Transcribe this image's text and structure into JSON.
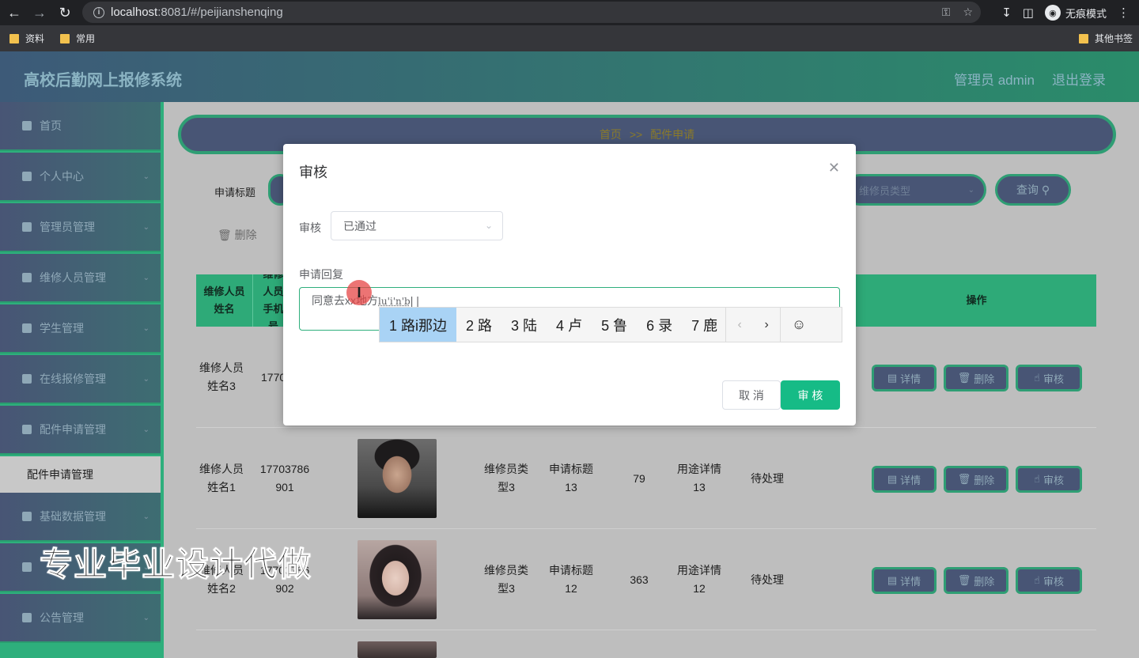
{
  "browser": {
    "url_host": "localhost",
    "url_rest": ":8081/#/peijianshenqing",
    "profile_label": "无痕模式",
    "bookmarks": [
      "资料",
      "常用"
    ],
    "other_bookmarks": "其他书签"
  },
  "header": {
    "title": "高校后勤网上报修系统",
    "user_label": "管理员 admin",
    "logout_label": "退出登录"
  },
  "sidebar": {
    "items": [
      {
        "label": "首页",
        "icon": "home-icon"
      },
      {
        "label": "个人中心",
        "icon": "user-icon"
      },
      {
        "label": "管理员管理",
        "icon": "monitor-icon"
      },
      {
        "label": "维修人员管理",
        "icon": "flag-icon"
      },
      {
        "label": "学生管理",
        "icon": "grid-icon"
      },
      {
        "label": "在线报修管理",
        "icon": "grid-icon"
      },
      {
        "label": "配件申请管理",
        "icon": "grid-icon"
      },
      {
        "label": "基础数据管理",
        "icon": "grid-icon"
      },
      {
        "label": "",
        "icon": "grid-icon"
      },
      {
        "label": "公告管理",
        "icon": "send-icon"
      }
    ],
    "active_sub": "配件申请管理"
  },
  "breadcrumb": {
    "home": "首页",
    "sep": ">>",
    "current": "配件申请"
  },
  "search": {
    "title_label": "申请标题",
    "type_placeholder": "维修员类型",
    "query_label": "查询"
  },
  "toolbar": {
    "delete_label": "删除"
  },
  "table": {
    "headers": [
      "维修人员姓名",
      "维修人员手机号",
      "操作"
    ],
    "rows": [
      {
        "name": "维修人员姓名3",
        "phone": "17703786903",
        "type": "",
        "title": "",
        "qty": "",
        "purpose": "",
        "status": ""
      },
      {
        "name": "维修人员姓名1",
        "phone": "17703786901",
        "type": "维修员类型3",
        "title": "申请标题13",
        "qty": "79",
        "purpose": "用途详情13",
        "status": "待处理"
      },
      {
        "name": "维修人员姓名2",
        "phone": "17703786902",
        "type": "维修员类型3",
        "title": "申请标题12",
        "qty": "363",
        "purpose": "用途详情12",
        "status": "待处理"
      }
    ],
    "actions": {
      "detail": "详情",
      "delete": "删除",
      "review": "审核"
    }
  },
  "watermark": "专业毕业设计代做",
  "dialog": {
    "title": "审核",
    "review_label": "审核",
    "review_value": "已通过",
    "reply_label": "申请回复",
    "reply_text": "同意去xx地方",
    "reply_pinyin": "lu'i'n'b",
    "cancel_label": "取 消",
    "confirm_label": "审 核"
  },
  "ime": {
    "candidates": [
      "1 路i那边",
      "2 路",
      "3 陆",
      "4 卢",
      "5 鲁",
      "6 录",
      "7 鹿"
    ]
  }
}
